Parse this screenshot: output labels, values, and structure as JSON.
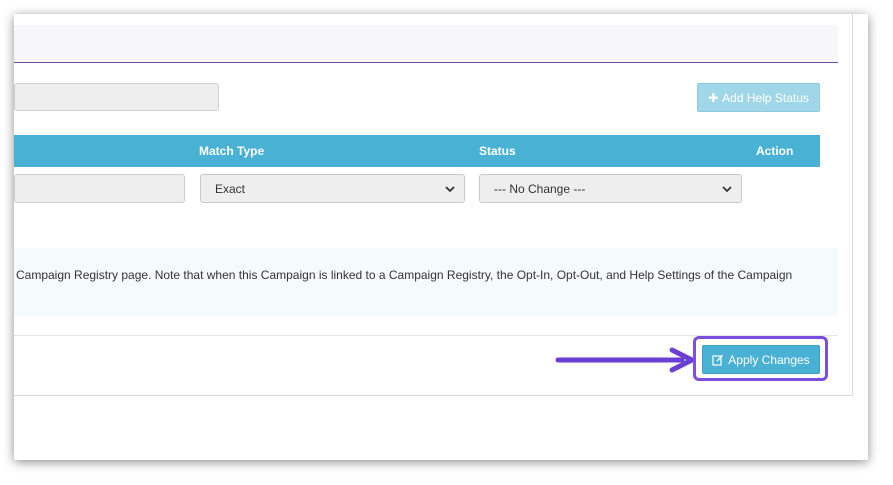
{
  "help": {
    "add_button_label": "Add Help Status",
    "add_icon": "plus-icon"
  },
  "table": {
    "headers": {
      "match_type": "Match Type",
      "status": "Status",
      "action": "Action"
    },
    "row": {
      "keyword_value": "",
      "match_type_value": "Exact",
      "status_value": "--- No Change ---"
    }
  },
  "note": {
    "text": "Campaign Registry page. Note that when this Campaign is linked to a Campaign Registry, the Opt-In, Opt-Out, and Help Settings of the Campaign"
  },
  "footer": {
    "apply_label": "Apply Changes",
    "apply_icon": "edit-icon"
  },
  "colors": {
    "accent": "#49b1d3",
    "highlight": "#7a4fe0",
    "disabled_button": "#9fd6e8"
  }
}
